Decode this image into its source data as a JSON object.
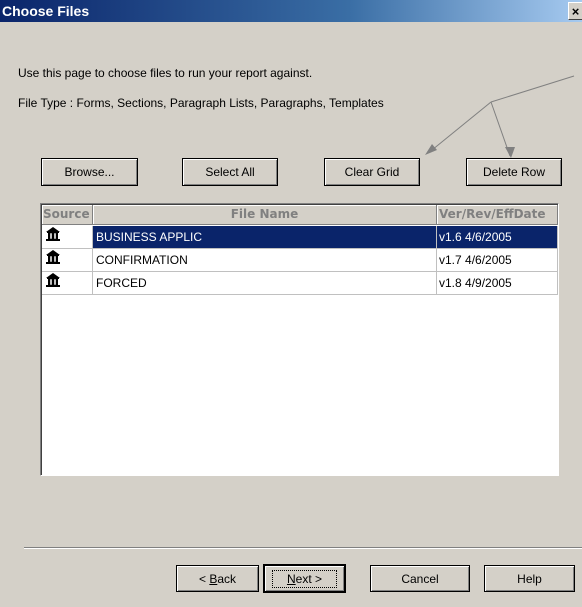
{
  "window": {
    "title": "Choose Files",
    "close_label": "×"
  },
  "intro": {
    "line1": "Use this page to choose files to run your report against.",
    "line2": "File Type : Forms, Sections, Paragraph Lists, Paragraphs, Templates"
  },
  "toolbar": {
    "browse_label": "Browse...",
    "select_all_label": "Select All",
    "clear_grid_label": "Clear Grid",
    "delete_row_label": "Delete Row"
  },
  "grid": {
    "columns": [
      "Source",
      "File Name",
      "Ver/Rev/EffDate"
    ],
    "rows": [
      {
        "source_icon": "library-icon",
        "file_name": "BUSINESS APPLIC",
        "version": "v1.6 4/6/2005",
        "selected": true
      },
      {
        "source_icon": "library-icon",
        "file_name": "CONFIRMATION",
        "version": "v1.7 4/6/2005",
        "selected": false
      },
      {
        "source_icon": "library-icon",
        "file_name": "FORCED",
        "version": "v1.8 4/9/2005",
        "selected": false
      }
    ]
  },
  "footer": {
    "back_prefix": "< ",
    "back_mnemonic": "B",
    "back_rest": "ack",
    "next_mnemonic": "N",
    "next_rest": "ext >",
    "cancel_label": "Cancel",
    "help_label": "Help"
  },
  "colors": {
    "title_bar": "#0a246a",
    "dialog_bg": "#d4d0c8",
    "selection": "#0a246a",
    "arrow": "#808080"
  }
}
